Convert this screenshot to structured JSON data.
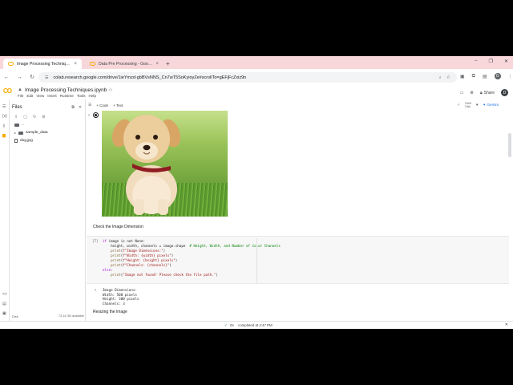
{
  "browser": {
    "tabs": [
      {
        "label": "Image Processing Techniques.ipynb - Colab",
        "active": true
      },
      {
        "label": "Data Pre Processing - Google Colab",
        "active": false
      }
    ],
    "url": "colab.research.google.com/drive/1ieYmzd-gbBVsNNS_Cn7wT5SoKyioyZe#scrollTo=gEFjFcZxiz9n",
    "profile_initial": "G"
  },
  "colab": {
    "logo_text": "CO",
    "notebook_title": "Image Processing Techniques.ipynb",
    "menu": [
      "File",
      "Edit",
      "View",
      "Insert",
      "Runtime",
      "Tools",
      "Help"
    ],
    "share_label": "Share",
    "user_initial": "D"
  },
  "toolbar": {
    "code_label": "+ Code",
    "text_label": "+ Text",
    "ram_label": "RAM",
    "disk_label": "Disk",
    "gemini_label": "Gemini"
  },
  "files_panel": {
    "title": "Files",
    "items": [
      {
        "name": "..",
        "type": "folder"
      },
      {
        "name": "sample_data",
        "type": "folder"
      },
      {
        "name": "dog.jpg",
        "type": "file"
      }
    ],
    "disk_label": "Disk",
    "disk_available": "73.14 GB available",
    "disk_used_fraction": 0.28
  },
  "cells": {
    "md_check": "Check the Image Dimension",
    "exec_count": "[7]",
    "code_lines": [
      {
        "parts": [
          {
            "t": "if",
            "c": "kw"
          },
          {
            "t": " image is not None:",
            "c": ""
          }
        ]
      },
      {
        "parts": [
          {
            "t": "    height, width, channels = image.shape  ",
            "c": ""
          },
          {
            "t": "# Height, Width, and Number of Color Channels",
            "c": "com"
          }
        ]
      },
      {
        "parts": [
          {
            "t": "    print",
            "c": "fn"
          },
          {
            "t": "(",
            "c": ""
          },
          {
            "t": "f\"Image Dimensions:\"",
            "c": "str"
          },
          {
            "t": ")",
            "c": ""
          }
        ]
      },
      {
        "parts": [
          {
            "t": "    print",
            "c": "fn"
          },
          {
            "t": "(",
            "c": ""
          },
          {
            "t": "f\"Width: {width} pixels\"",
            "c": "str"
          },
          {
            "t": ")",
            "c": ""
          }
        ]
      },
      {
        "parts": [
          {
            "t": "    print",
            "c": "fn"
          },
          {
            "t": "(",
            "c": ""
          },
          {
            "t": "f\"Height: {height} pixels\"",
            "c": "str"
          },
          {
            "t": ")",
            "c": ""
          }
        ]
      },
      {
        "parts": [
          {
            "t": "    print",
            "c": "fn"
          },
          {
            "t": "(",
            "c": ""
          },
          {
            "t": "f\"Channels: {channels}\"",
            "c": "str"
          },
          {
            "t": ")",
            "c": ""
          }
        ]
      },
      {
        "parts": [
          {
            "t": "else",
            "c": "kw"
          },
          {
            "t": ":",
            "c": ""
          }
        ]
      },
      {
        "parts": [
          {
            "t": "    print",
            "c": "fn"
          },
          {
            "t": "(",
            "c": ""
          },
          {
            "t": "\"Image not found! Please check the file path.\"",
            "c": "str"
          },
          {
            "t": ")",
            "c": ""
          }
        ]
      }
    ],
    "output_lines": [
      "Image Dimensions:",
      "Width: 500 pixels",
      "Height: 300 pixels",
      "Channels: 3"
    ],
    "md_resize": "Resizing the Image"
  },
  "status": {
    "duration": "0s",
    "completed": "completed at 2:47 PM"
  }
}
